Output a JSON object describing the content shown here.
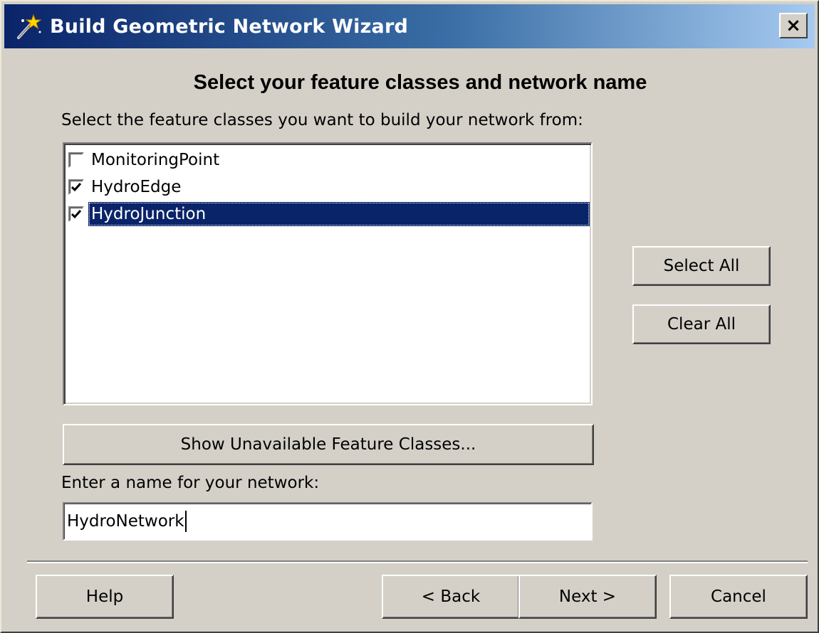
{
  "window": {
    "title": "Build Geometric Network Wizard",
    "close_label": "×"
  },
  "heading": "Select your feature classes and network name",
  "feature_classes": {
    "prompt": "Select the feature classes you want to build your network from:",
    "items": [
      {
        "label": "MonitoringPoint",
        "checked": false,
        "selected": false
      },
      {
        "label": "HydroEdge",
        "checked": true,
        "selected": false
      },
      {
        "label": "HydroJunction",
        "checked": true,
        "selected": true
      }
    ],
    "select_all_label": "Select All",
    "clear_all_label": "Clear All",
    "show_unavailable_label": "Show Unavailable Feature Classes..."
  },
  "network_name": {
    "prompt": "Enter a name for your network:",
    "value": "HydroNetwork"
  },
  "footer": {
    "help_label": "Help",
    "back_label": "< Back",
    "next_label": "Next >",
    "cancel_label": "Cancel"
  },
  "icons": {
    "title_icon": "wizard-wand-icon",
    "checkmark": "check-icon"
  },
  "colors": {
    "selection": "#0a246a",
    "face": "#d4d0c8",
    "title_gradient_start": "#0a246a",
    "title_gradient_end": "#a6caf0"
  }
}
